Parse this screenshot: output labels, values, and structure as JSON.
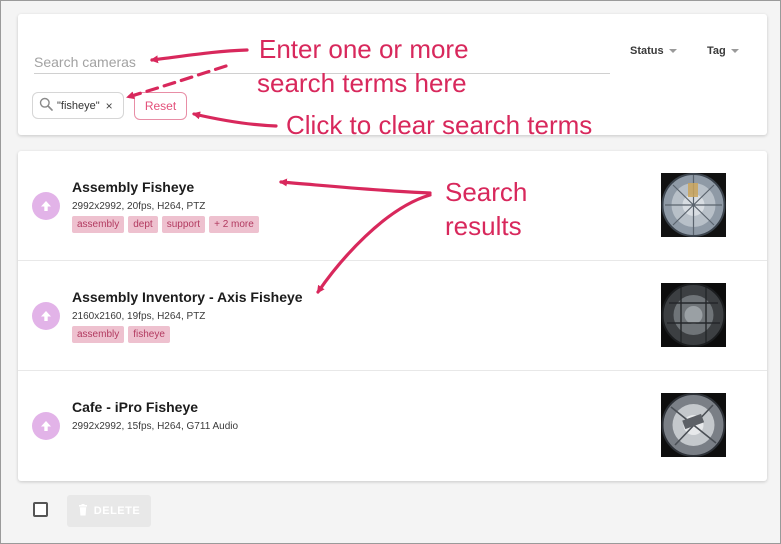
{
  "search": {
    "placeholder": "Search cameras",
    "term_chip": "\"fisheye\"",
    "term_remove": "×",
    "reset_label": "Reset"
  },
  "filters": {
    "status_label": "Status",
    "tag_label": "Tag"
  },
  "cameras": [
    {
      "name": "Assembly Fisheye",
      "spec": "2992x2992, 20fps, H264, PTZ",
      "tags": [
        "assembly",
        "dept",
        "support",
        "+ 2 more"
      ]
    },
    {
      "name": "Assembly Inventory - Axis Fisheye",
      "spec": "2160x2160, 19fps, H264, PTZ",
      "tags": [
        "assembly",
        "fisheye"
      ]
    },
    {
      "name": "Cafe - iPro Fisheye",
      "spec": "2992x2992, 15fps, H264, G711 Audio",
      "tags": []
    }
  ],
  "footer": {
    "delete_label": "DELETE"
  },
  "annotations": {
    "enter_line1": "Enter one or more",
    "enter_line2": "search terms here",
    "clear": "Click to clear search terms",
    "results_line1": "Search",
    "results_line2": "results"
  },
  "colors": {
    "accent": "#d8285c",
    "tag_bg": "#eec1cf",
    "tag_text": "#b23a60",
    "upload_circle": "#e2b3e8"
  },
  "icons": {
    "search": "magnifier-icon",
    "upload": "arrow-up-icon",
    "delete": "trash-icon"
  }
}
